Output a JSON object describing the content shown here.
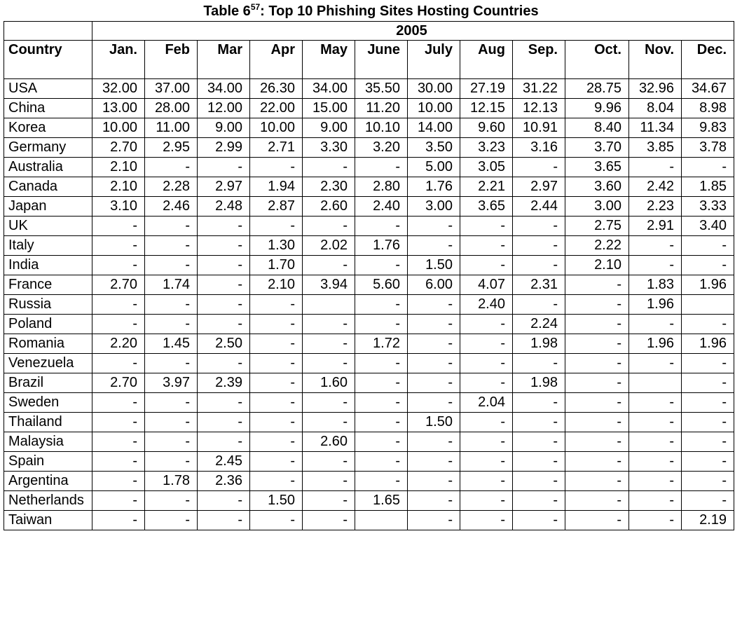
{
  "caption": {
    "prefix": "Table 6",
    "superscript": "57",
    "suffix": ": Top 10 Phishing Sites Hosting Countries"
  },
  "table": {
    "year_header": "2005",
    "country_header": "Country",
    "months": [
      "Jan.",
      "Feb",
      "Mar",
      "Apr",
      "May",
      "June",
      "July",
      "Aug",
      "Sep.",
      "Oct.",
      "Nov.",
      "Dec."
    ],
    "rows": [
      {
        "country": "USA",
        "values": [
          "32.00",
          "37.00",
          "34.00",
          "26.30",
          "34.00",
          "35.50",
          "30.00",
          "27.19",
          "31.22",
          "28.75",
          "32.96",
          "34.67"
        ]
      },
      {
        "country": "China",
        "values": [
          "13.00",
          "28.00",
          "12.00",
          "22.00",
          "15.00",
          "11.20",
          "10.00",
          "12.15",
          "12.13",
          "9.96",
          "8.04",
          "8.98"
        ]
      },
      {
        "country": "Korea",
        "values": [
          "10.00",
          "11.00",
          "9.00",
          "10.00",
          "9.00",
          "10.10",
          "14.00",
          "9.60",
          "10.91",
          "8.40",
          "11.34",
          "9.83"
        ]
      },
      {
        "country": "Germany",
        "values": [
          "2.70",
          "2.95",
          "2.99",
          "2.71",
          "3.30",
          "3.20",
          "3.50",
          "3.23",
          "3.16",
          "3.70",
          "3.85",
          "3.78"
        ]
      },
      {
        "country": "Australia",
        "values": [
          "2.10",
          "-",
          "-",
          "-",
          "-",
          "-",
          "5.00",
          "3.05",
          "-",
          "3.65",
          "-",
          "-"
        ]
      },
      {
        "country": "Canada",
        "values": [
          "2.10",
          "2.28",
          "2.97",
          "1.94",
          "2.30",
          "2.80",
          "1.76",
          "2.21",
          "2.97",
          "3.60",
          "2.42",
          "1.85"
        ]
      },
      {
        "country": "Japan",
        "values": [
          "3.10",
          "2.46",
          "2.48",
          "2.87",
          "2.60",
          "2.40",
          "3.00",
          "3.65",
          "2.44",
          "3.00",
          "2.23",
          "3.33"
        ]
      },
      {
        "country": "UK",
        "values": [
          "-",
          "-",
          "-",
          "-",
          "-",
          "-",
          "-",
          "-",
          "-",
          "2.75",
          "2.91",
          "3.40"
        ]
      },
      {
        "country": "Italy",
        "values": [
          "-",
          "-",
          "-",
          "1.30",
          "2.02",
          "1.76",
          "-",
          "-",
          "-",
          "2.22",
          "-",
          "-"
        ]
      },
      {
        "country": "India",
        "values": [
          "-",
          "-",
          "-",
          "1.70",
          "-",
          "-",
          "1.50",
          "-",
          "-",
          "2.10",
          "-",
          "-"
        ]
      },
      {
        "country": "France",
        "values": [
          "2.70",
          "1.74",
          "-",
          "2.10",
          "3.94",
          "5.60",
          "6.00",
          "4.07",
          "2.31",
          "-",
          "1.83",
          "1.96"
        ]
      },
      {
        "country": "Russia",
        "values": [
          "-",
          "-",
          "-",
          "-",
          "",
          "-",
          "-",
          "2.40",
          "-",
          "-",
          "1.96",
          ""
        ]
      },
      {
        "country": "Poland",
        "values": [
          "-",
          "-",
          "-",
          "-",
          "-",
          "-",
          "-",
          "-",
          "2.24",
          "-",
          "-",
          "-"
        ]
      },
      {
        "country": "Romania",
        "values": [
          "2.20",
          "1.45",
          "2.50",
          "-",
          "-",
          "1.72",
          "-",
          "-",
          "1.98",
          "-",
          "1.96",
          "1.96"
        ]
      },
      {
        "country": "Venezuela",
        "values": [
          "-",
          "-",
          "-",
          "-",
          "-",
          "-",
          "-",
          "-",
          "-",
          "-",
          "-",
          "-"
        ]
      },
      {
        "country": "Brazil",
        "values": [
          "2.70",
          "3.97",
          "2.39",
          "-",
          "1.60",
          "-",
          "-",
          "-",
          "1.98",
          "-",
          "",
          "-"
        ]
      },
      {
        "country": "Sweden",
        "values": [
          "-",
          "-",
          "-",
          "-",
          "-",
          "-",
          "-",
          "2.04",
          "-",
          "-",
          "-",
          "-"
        ]
      },
      {
        "country": "Thailand",
        "values": [
          "-",
          "-",
          "-",
          "-",
          "-",
          "-",
          "1.50",
          "-",
          "-",
          "-",
          "-",
          "-"
        ]
      },
      {
        "country": "Malaysia",
        "values": [
          "-",
          "-",
          "-",
          "-",
          "2.60",
          "-",
          "-",
          "-",
          "-",
          "-",
          "-",
          "-"
        ]
      },
      {
        "country": "Spain",
        "values": [
          "-",
          "-",
          "2.45",
          "-",
          "-",
          "-",
          "-",
          "-",
          "-",
          "-",
          "-",
          "-"
        ]
      },
      {
        "country": "Argentina",
        "values": [
          "-",
          "1.78",
          "2.36",
          "-",
          "-",
          "-",
          "-",
          "-",
          "-",
          "-",
          "-",
          "-"
        ]
      },
      {
        "country": "Netherlands",
        "values": [
          "-",
          "-",
          "-",
          "1.50",
          "-",
          "1.65",
          "-",
          "-",
          "-",
          "-",
          "-",
          "-"
        ]
      },
      {
        "country": "Taiwan",
        "values": [
          "-",
          "-",
          "-",
          "-",
          "-",
          "",
          "-",
          "-",
          "-",
          "-",
          "-",
          "2.19"
        ]
      }
    ]
  }
}
